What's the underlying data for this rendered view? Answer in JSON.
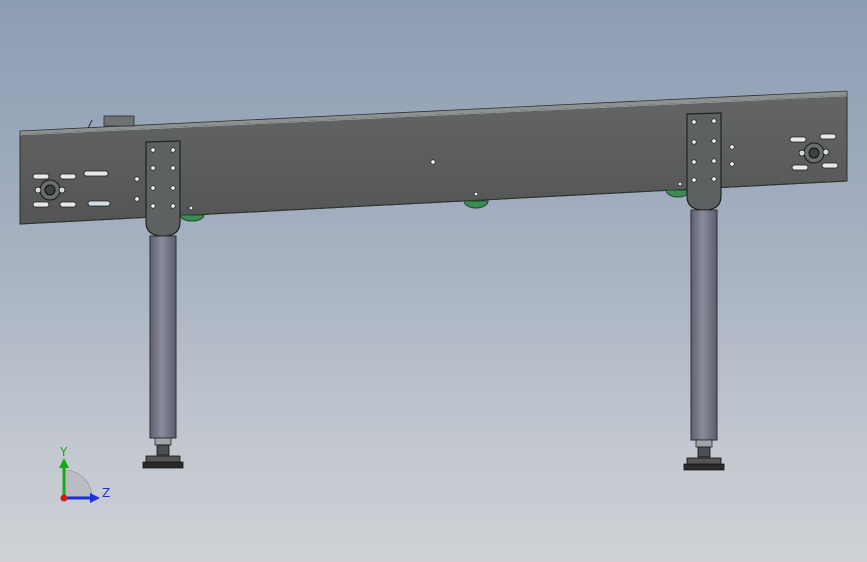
{
  "viewport": {
    "background_top": "#8c9db3",
    "background_bottom": "#cfd1d5"
  },
  "model": {
    "frame_color": "#5a5c5c",
    "leg_color": "#7d7f90",
    "roller_color": "#3d8a55",
    "foot_color": "#2a2a2a"
  },
  "triad": {
    "y_label": "Y",
    "z_label": "Z",
    "y_color": "#18a818",
    "z_color": "#1c2fd8",
    "x_color": "#d41c1c"
  }
}
